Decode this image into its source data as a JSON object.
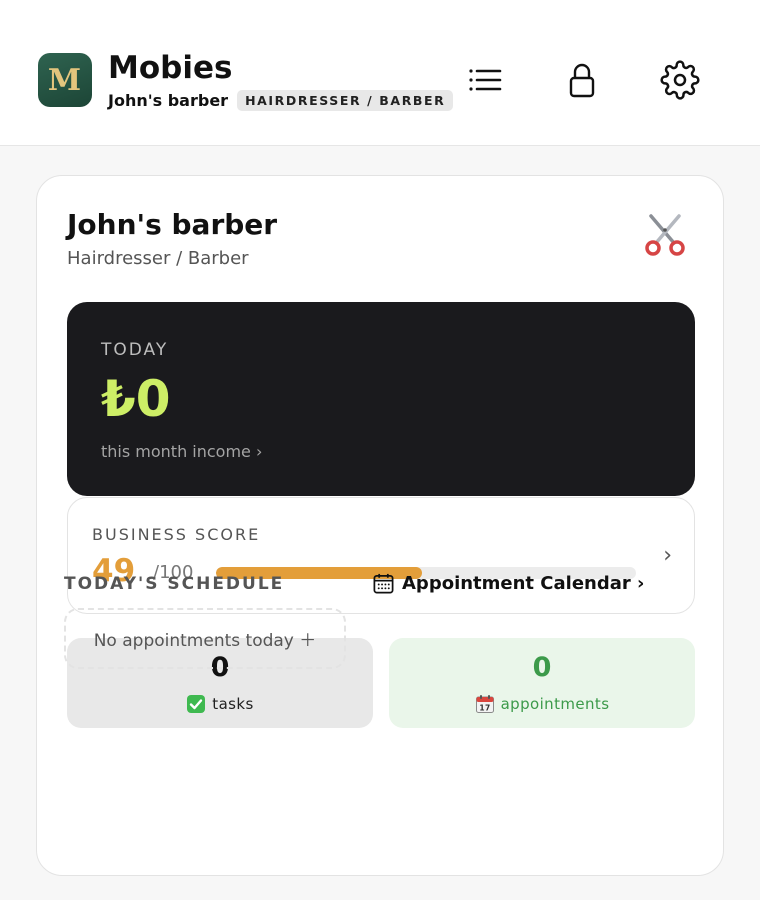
{
  "header": {
    "logo_letter": "M",
    "app_name": "Mobies",
    "business_name": "John's barber",
    "category_badge": "HAIRDRESSER / BARBER",
    "icons": [
      "list-icon",
      "lock-icon",
      "gear-icon"
    ]
  },
  "business": {
    "title": "John's barber",
    "subtitle": "Hairdresser / Barber",
    "icon": "scissors-icon"
  },
  "income": {
    "label": "TODAY",
    "value": "₺0",
    "link": "this month income ›",
    "accent_color": "#cdee66"
  },
  "score": {
    "label": "BUSINESS SCORE",
    "value": "49",
    "max": "/100",
    "fraction": 0.49,
    "color": "#e39e3a",
    "chevron": "›"
  },
  "tiles": {
    "tasks": {
      "count": "0",
      "label": "tasks",
      "icon": "check-icon"
    },
    "appointments": {
      "count": "0",
      "label": "appointments",
      "icon": "calendar-icon",
      "color": "#3c9a4a"
    }
  },
  "schedule": {
    "label": "TODAY'S SCHEDULE",
    "calendar_link": "Appointment Calendar ›",
    "empty_text": "No appointments today ＋"
  }
}
